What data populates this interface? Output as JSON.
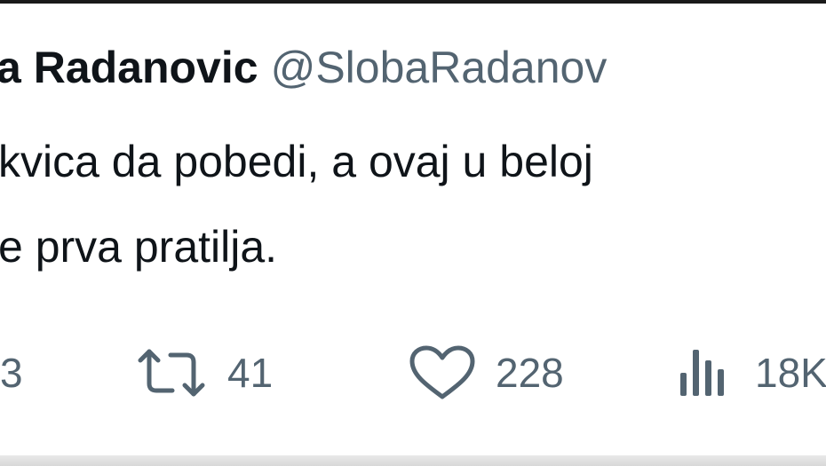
{
  "tweet": {
    "display_name": "a Radanovic",
    "handle": "@SlobaRadanov",
    "text_line1": "kvica da pobedi, a ovaj u beloj",
    "text_line2": "e prva pratilja."
  },
  "actions": {
    "replies": "3",
    "retweets": "41",
    "likes": "228",
    "views": "18K"
  },
  "icons": {
    "retweet": "retweet-icon",
    "like": "heart-icon",
    "views": "bar-chart-icon"
  },
  "colors": {
    "text": "#0f1419",
    "secondary": "#536471"
  }
}
